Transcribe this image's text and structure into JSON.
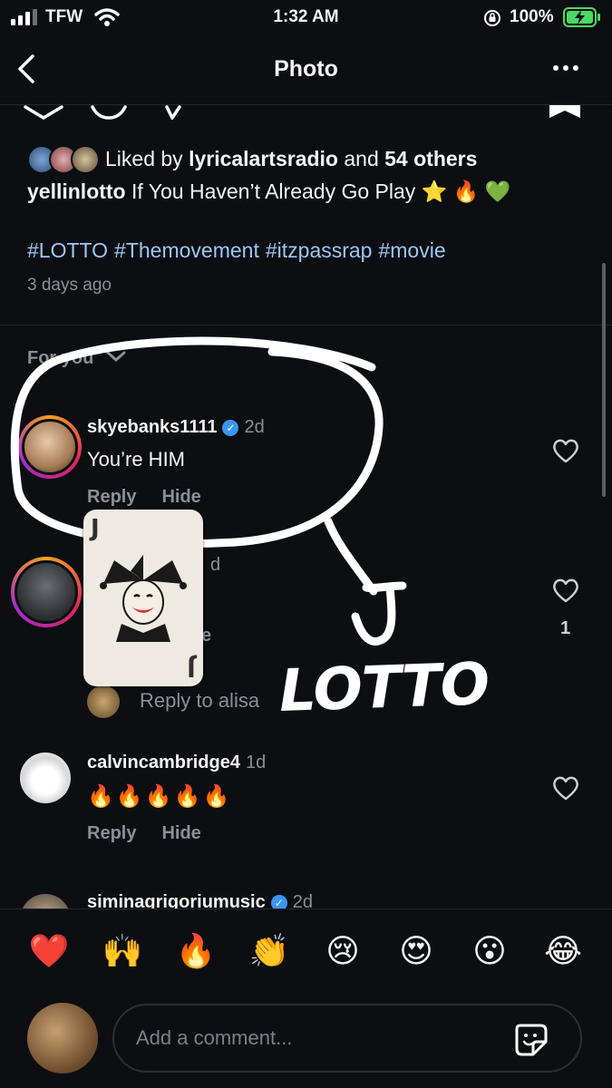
{
  "status_bar": {
    "carrier": "TFW",
    "time": "1:32 AM",
    "battery": "100%"
  },
  "nav": {
    "title": "Photo"
  },
  "post": {
    "liked_by_prefix": "Liked by",
    "liked_by_user": "lyricalartsradio",
    "liked_by_and": "and",
    "liked_by_others": "54 others",
    "caption_user": "yellinlotto",
    "caption_text": "If You Haven’t Already Go Play ⭐️ 🔥 💚",
    "hashtags": [
      "#LOTTO",
      "#Themovement",
      "#itzpassrap",
      "#movie"
    ],
    "time_ago": "3 days ago"
  },
  "comments_filter": {
    "label": "For you"
  },
  "comments": [
    {
      "user": "skyebanks1111",
      "age": "2d",
      "verified": "✓",
      "text": "You’re HIM",
      "reply_label": "Reply",
      "hide_label": "Hide"
    },
    {
      "age_partial": "d",
      "like_count": "1",
      "partial_e": "e",
      "view_replies_text": "Reply to alisa"
    },
    {
      "user": "calvincambridge4",
      "age": "1d",
      "text": "🔥🔥🔥🔥🔥",
      "reply_label": "Reply",
      "hide_label": "Hide"
    },
    {
      "user": "siminagrigoriumusic",
      "age": "2d",
      "verified": "✓"
    }
  ],
  "reactions": [
    "❤️",
    "🙌",
    "🔥",
    "👏",
    "😢",
    "😍",
    "😮",
    "😂"
  ],
  "comment_input": {
    "placeholder": "Add a comment..."
  },
  "overlay": {
    "lotto_text": "LOTTO",
    "card_rank": "J"
  },
  "colors": {
    "background": "#0c0e12",
    "hashtag": "#9ec7f2",
    "muted": "#8b8f96",
    "verified": "#3897f0",
    "battery": "#4cd964"
  }
}
